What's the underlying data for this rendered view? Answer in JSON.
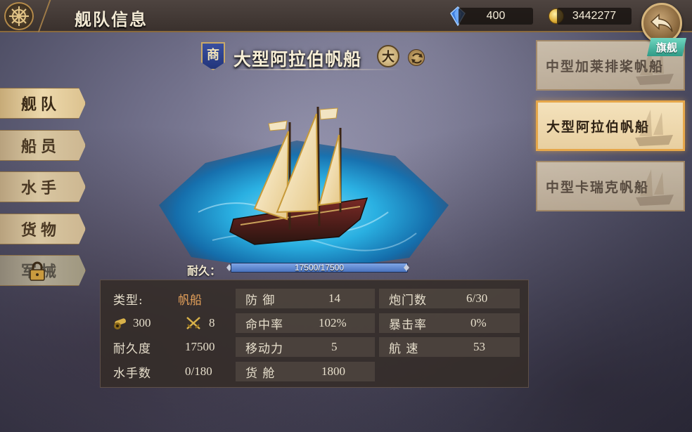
{
  "header": {
    "title": "舰队信息",
    "gems": "400",
    "gold": "3442277"
  },
  "nav": {
    "items": [
      {
        "label": "舰队",
        "state": "active"
      },
      {
        "label": "船员",
        "state": "normal"
      },
      {
        "label": "水手",
        "state": "normal"
      },
      {
        "label": "货物",
        "state": "normal"
      },
      {
        "label": "军械",
        "state": "locked"
      }
    ]
  },
  "ship": {
    "category_badge": "商",
    "name": "大型阿拉伯帆船",
    "size_badge": "大",
    "durability_label": "耐久：",
    "durability_text": "17500/17500",
    "durability_fraction": 1.0
  },
  "stats": {
    "type_label": "类型:",
    "type_value": "帆船",
    "cannon_icon_value": "300",
    "swords_icon_value": "8",
    "durability_label": "耐久度",
    "durability_value": "17500",
    "sailors_label": "水手数",
    "sailors_value": "0/180",
    "defense_label": "防 御",
    "defense_value": "14",
    "accuracy_label": "命中率",
    "accuracy_value": "102%",
    "mobility_label": "移动力",
    "mobility_value": "5",
    "cargo_label": "货 舱",
    "cargo_value": "1800",
    "gunports_label": "炮门数",
    "gunports_value": "6/30",
    "crit_label": "暴击率",
    "crit_value": "0%",
    "speed_label": "航 速",
    "speed_value": "53"
  },
  "fleet": {
    "flagship_tag": "旗舰",
    "ships": [
      {
        "name": "中型加莱排桨帆船",
        "state": "normal"
      },
      {
        "name": "大型阿拉伯帆船",
        "state": "selected"
      },
      {
        "name": "中型卡瑞克帆船",
        "state": "normal"
      }
    ]
  },
  "colors": {
    "accent_gold": "#b48a4a",
    "highlight_orange": "#e5a15a",
    "selected_border": "#e6a74a",
    "flagship_teal": "#2f9a86"
  }
}
